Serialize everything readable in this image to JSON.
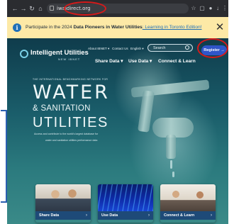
{
  "browser": {
    "url": "iwaidirect.org",
    "nav_icons": [
      "back-icon",
      "forward-icon",
      "reload-icon",
      "home-icon"
    ],
    "tool_icons": [
      "star-icon",
      "extension-icon",
      "profile-icon",
      "download-icon",
      "menu-icon"
    ]
  },
  "banner": {
    "lead": "Participate in the 2024 ",
    "bold": "Data Pioneers in Water Utilities",
    "link": ": Learning in Toronto Edition!",
    "close": "✕"
  },
  "site": {
    "logo": "Intelligent Utilities",
    "logo_sub": "NEW IBNET",
    "top_links": [
      "About IBNET ▾",
      "Contact Us",
      "English ▾"
    ],
    "search_placeholder": "Search",
    "register": "Register →",
    "menu": [
      "Share Data ▾",
      "Use Data ▾",
      "Connect & Learn"
    ]
  },
  "hero": {
    "tagline": "THE INTERNATIONAL BENCHMARKING NETWORK FOR",
    "water": "WATER",
    "sanitation": "& SANITATION",
    "utilities": "UTILITIES",
    "lede1": "Access and contribute to the world's largest database for",
    "lede2": "water and sanitation utilities performance data"
  },
  "cards": [
    {
      "label": "Share Data",
      "arrow": "›"
    },
    {
      "label": "Use Data",
      "arrow": "›"
    },
    {
      "label": "Connect & Learn",
      "arrow": "›"
    }
  ],
  "colors": {
    "annotation": "#d61a1a",
    "register": "#2f55c9",
    "banner": "#fde9a6",
    "card_bar": "#1e4a78"
  }
}
